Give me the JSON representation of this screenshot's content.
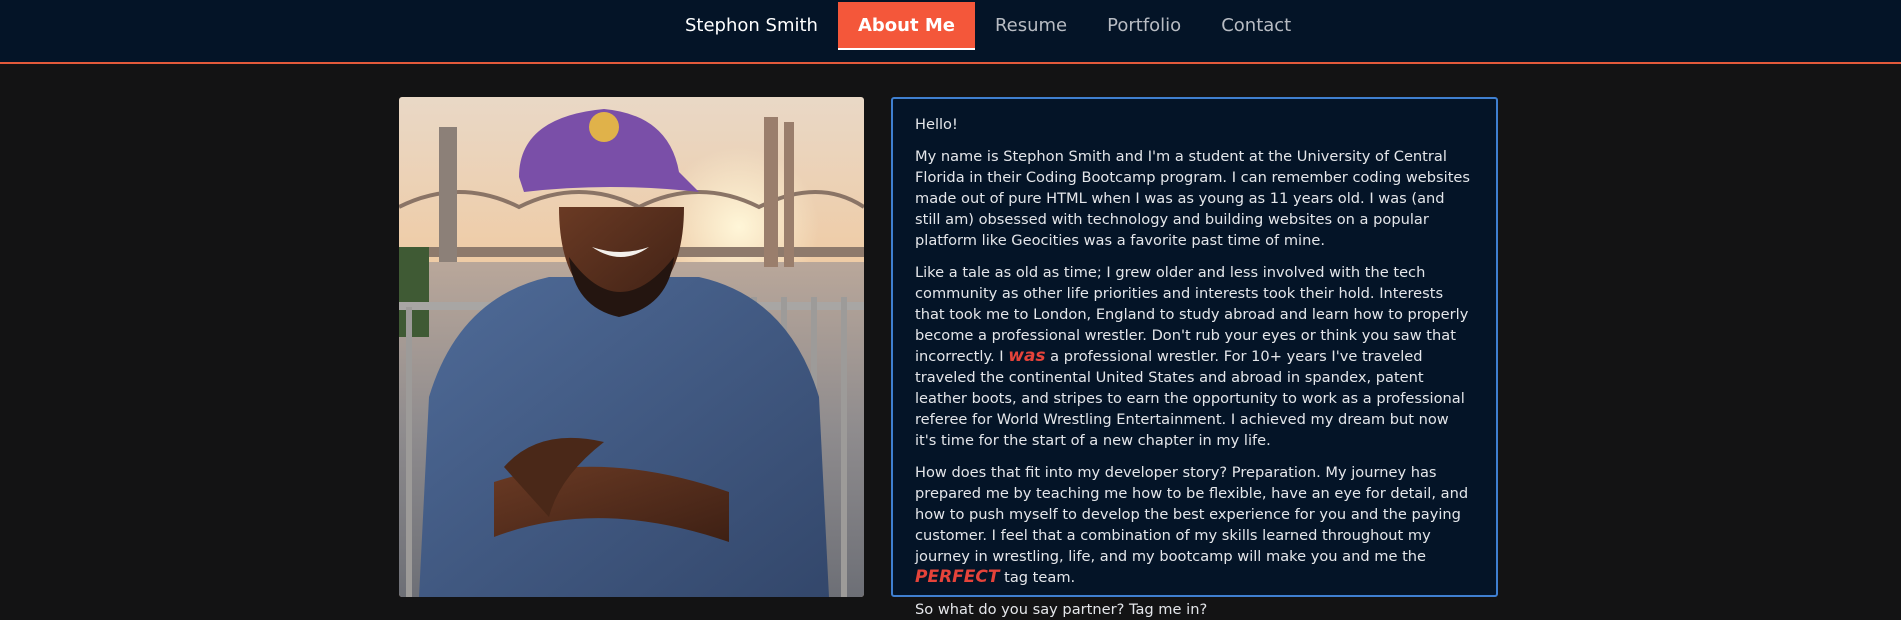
{
  "nav": {
    "brand": "Stephon Smith",
    "links": [
      "About Me",
      "Resume",
      "Portfolio",
      "Contact"
    ],
    "active_index": 0
  },
  "colors": {
    "nav_bg": "#041427",
    "accent": "#f4573a",
    "page_bg": "#131314",
    "card_border": "#3f7fd0",
    "highlight": "#e5433a"
  },
  "photo": {
    "alt": "Stephon Smith"
  },
  "bio": {
    "greeting": "Hello!",
    "p1": "My name is Stephon Smith and I'm a student at the University of Central Florida in their Coding Bootcamp program. I can remember coding websites made out of pure HTML when I was as young as 11 years old. I was (and still am) obsessed with technology and building websites on a popular platform like Geocities was a favorite past time of mine.",
    "p2_before": "Like a tale as old as time; I grew older and less involved with the tech community as other life priorities and interests took their hold. Interests that took me to London, England to study abroad and learn how to properly become a professional wrestler. Don't rub your eyes or think you saw that incorrectly. I ",
    "p2_highlight": "was",
    "p2_after": " a professional wrestler. For 10+ years I've traveled traveled the continental United States and abroad in spandex, patent leather boots, and stripes to earn the opportunity to work as a professional referee for World Wrestling Entertainment. I achieved my dream but now it's time for the start of a new chapter in my life.",
    "p3_before": "How does that fit into my developer story? Preparation. My journey has prepared me by teaching me how to be flexible, have an eye for detail, and how to push myself to develop the best experience for you and the paying customer. I feel that a combination of my skills learned throughout my journey in wrestling, life, and my bootcamp will make you and me the ",
    "p3_highlight": "PERFECT",
    "p3_after": " tag team.",
    "closing": "So what do you say partner? Tag me in?"
  }
}
